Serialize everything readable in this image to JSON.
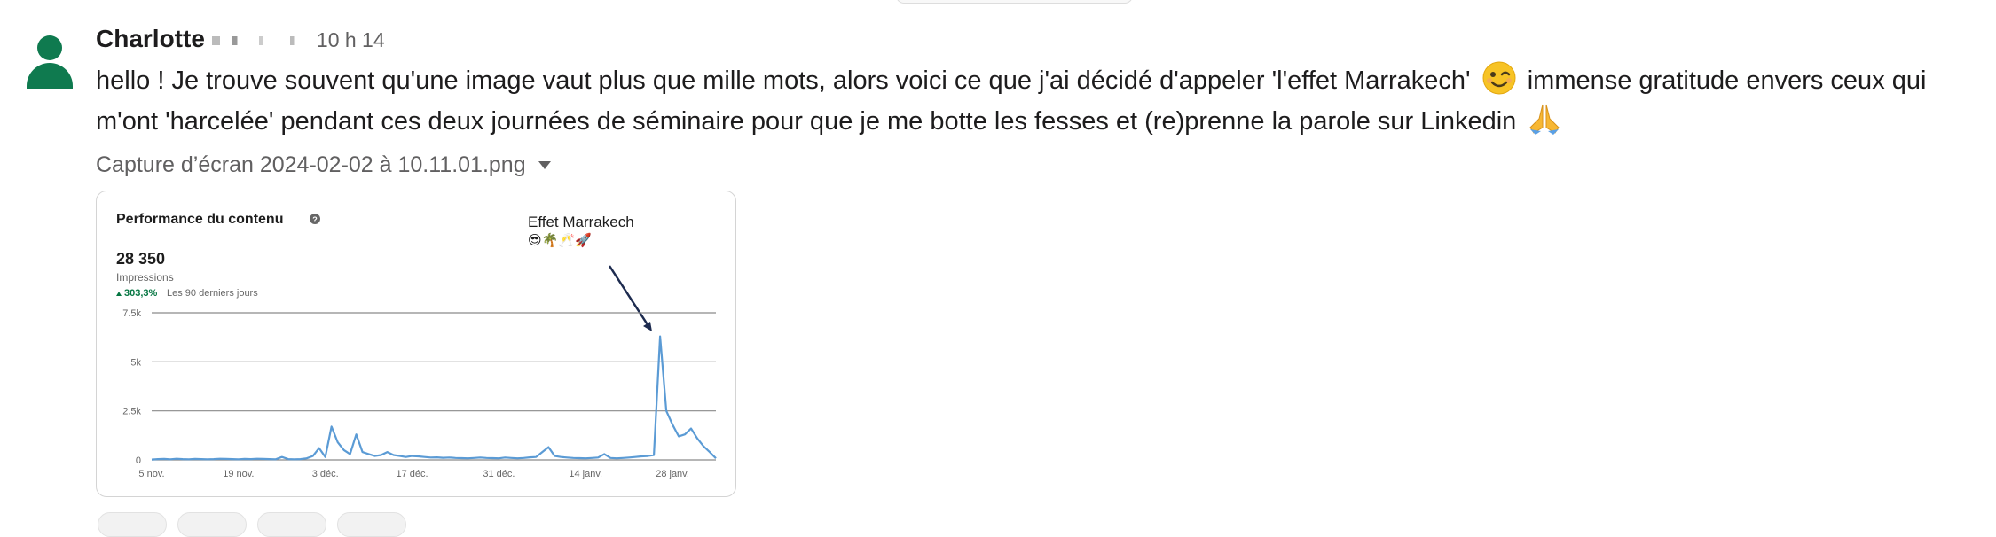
{
  "message": {
    "sender": "Charlotte",
    "timestamp": "10 h 14",
    "text_line1_a": "hello ! Je trouve souvent qu'une image vaut plus que mille mots, alors voici ce que j'ai décidé d'appeler 'l'effet Marrakech'",
    "text_line1_b": "immense gratitude envers ceux qui",
    "text_line2": "m'ont 'harcelée' pendant ces deux journées de séminaire pour que je me botte les fesses et (re)prenne la parole sur Linkedin",
    "emoji_1": "wink-emoji",
    "emoji_2": "pray-emoji"
  },
  "attachment": {
    "filename": "Capture d’écran 2024-02-02 à 10.11.01.png",
    "menu_icon": "caret-down-icon"
  },
  "card": {
    "title": "Performance du contenu",
    "help_icon": "question-circle-icon",
    "impressions_value": "28 350",
    "impressions_label": "Impressions",
    "change_value": "303,3%",
    "change_label": "Les 90 derniers jours",
    "change_color": "#057642",
    "annotation_title": "Effet Marrakech",
    "annotation_emojis": "😎🌴🥂🚀"
  },
  "chart_data": {
    "type": "line",
    "color": "#5b9bd5",
    "ylim": [
      0,
      7500
    ],
    "y_ticks": [
      {
        "value": 0,
        "label": "0"
      },
      {
        "value": 2500,
        "label": "2.5k"
      },
      {
        "value": 5000,
        "label": "5k"
      },
      {
        "value": 7500,
        "label": "7.5k"
      }
    ],
    "x_tick_labels": [
      "5 nov.",
      "19 nov.",
      "3 déc.",
      "17 déc.",
      "31 déc.",
      "14 janv.",
      "28 janv."
    ],
    "x_tick_indices": [
      0,
      14,
      28,
      42,
      56,
      70,
      84
    ],
    "values": [
      20,
      40,
      50,
      30,
      60,
      40,
      30,
      50,
      40,
      30,
      40,
      60,
      50,
      40,
      30,
      50,
      40,
      60,
      50,
      40,
      30,
      150,
      40,
      30,
      40,
      80,
      200,
      600,
      150,
      1700,
      900,
      500,
      300,
      1300,
      400,
      300,
      200,
      250,
      400,
      250,
      200,
      150,
      200,
      180,
      150,
      120,
      130,
      110,
      120,
      100,
      90,
      80,
      100,
      120,
      100,
      90,
      80,
      120,
      100,
      80,
      100,
      130,
      150,
      400,
      650,
      200,
      150,
      120,
      100,
      90,
      80,
      100,
      120,
      300,
      100,
      80,
      100,
      120,
      150,
      180,
      200,
      250,
      6300,
      2500,
      1800,
      1200,
      1300,
      1600,
      1100,
      700,
      400,
      80
    ]
  },
  "reactions": [
    "reaction-1",
    "reaction-2",
    "reaction-3",
    "reaction-4"
  ]
}
